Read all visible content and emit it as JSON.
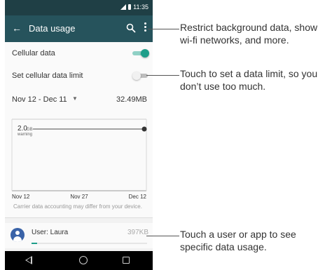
{
  "status_bar": {
    "time": "11:35"
  },
  "app_bar": {
    "title": "Data usage",
    "back_icon": "arrow-left-icon",
    "search_icon": "search-icon",
    "more_icon": "more-vert-icon"
  },
  "settings": {
    "cellular_data": {
      "label": "Cellular data",
      "enabled": true
    },
    "cellular_limit": {
      "label": "Set cellular data limit",
      "enabled": false
    }
  },
  "cycle": {
    "date_range": "Nov 12 - Dec 11",
    "total": "32.49MB"
  },
  "chart": {
    "warning_value": "2.0",
    "warning_unit": "GB",
    "warning_label": "warning",
    "x_labels": [
      "Nov 12",
      "Nov 27",
      "Dec 12"
    ],
    "note": "Carrier data accounting may differ from your device."
  },
  "user_row": {
    "name": "User: Laura",
    "usage": "397KB",
    "usage_fraction": 0.05
  },
  "callouts": [
    "Restrict background data, show wi-fi networks, and more.",
    "Touch to set a data limit, so you don’t use too much.",
    "Touch a user or app to see specific data usage."
  ],
  "colors": {
    "status_bar": "#1f3f45",
    "app_bar": "#26535c",
    "accent": "#1f9e8a",
    "avatar": "#3a63a8"
  }
}
